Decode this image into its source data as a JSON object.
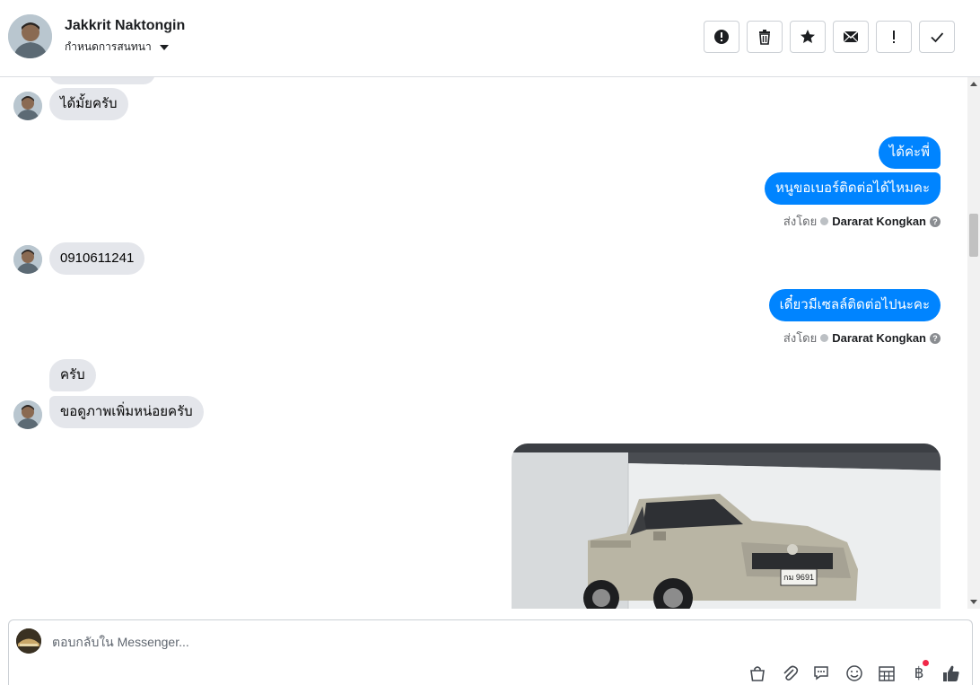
{
  "header": {
    "name": "Jakkrit Naktongin",
    "subtitle": "กำหนดการสนทนา"
  },
  "toolbar": {
    "buttons": [
      {
        "icon": "alert-circle-icon"
      },
      {
        "icon": "trash-icon"
      },
      {
        "icon": "star-icon"
      },
      {
        "icon": "envelope-icon"
      },
      {
        "icon": "exclamation-icon"
      },
      {
        "icon": "check-icon"
      }
    ]
  },
  "messages": {
    "m1": "ได้มั้ยครับ",
    "m2": "ได้ค่ะพี่",
    "m3": "หนูขอเบอร์ติดต่อได้ไหมคะ",
    "sent1_prefix": "ส่งโดย",
    "sent1_sender": "Dararat Kongkan",
    "m4": "0910611241",
    "m5": "เดี๋ยวมีเซลล์ติดต่อไปนะคะ",
    "sent2_prefix": "ส่งโดย",
    "sent2_sender": "Dararat Kongkan",
    "m6": "ครับ",
    "m7": "ขอดูภาพเพิ่มหน่อยครับ",
    "plate": "กม 9691"
  },
  "composer": {
    "placeholder": "ตอบกลับใน Messenger...",
    "tools": [
      "bag-icon",
      "paperclip-icon",
      "chat-bubbles-icon",
      "smiley-icon",
      "table-icon",
      "baht-icon",
      "thumbs-up-icon"
    ],
    "baht_symbol": "฿"
  },
  "colors": {
    "outgoing": "#0084ff",
    "incoming": "#e4e6eb",
    "notification_dot": "#f02849"
  }
}
